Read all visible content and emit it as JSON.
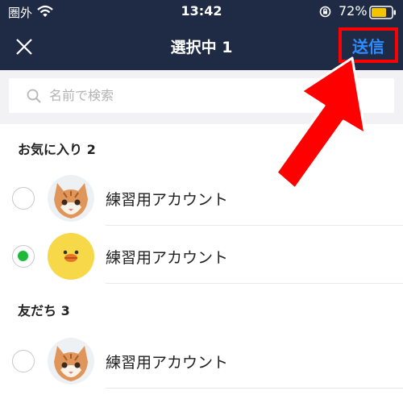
{
  "status_bar": {
    "carrier": "圏外",
    "time": "13:42",
    "battery": "72%"
  },
  "nav": {
    "title": "選択中 1",
    "send_label": "送信"
  },
  "search": {
    "placeholder": "名前で検索",
    "value": ""
  },
  "sections": {
    "favorites": {
      "label": "お気に入り 2"
    },
    "friends": {
      "label": "友だち 3"
    }
  },
  "rows": [
    {
      "name": "練習用アカウント",
      "checked": false,
      "avatar": "cat"
    },
    {
      "name": "練習用アカウント",
      "checked": true,
      "avatar": "duck"
    },
    {
      "name": "練習用アカウント",
      "checked": false,
      "avatar": "cat"
    }
  ],
  "colors": {
    "header_bg": "#1f2a44",
    "send_text": "#2f8cff",
    "highlight": "#ff0000",
    "checked": "#1fb93a"
  }
}
